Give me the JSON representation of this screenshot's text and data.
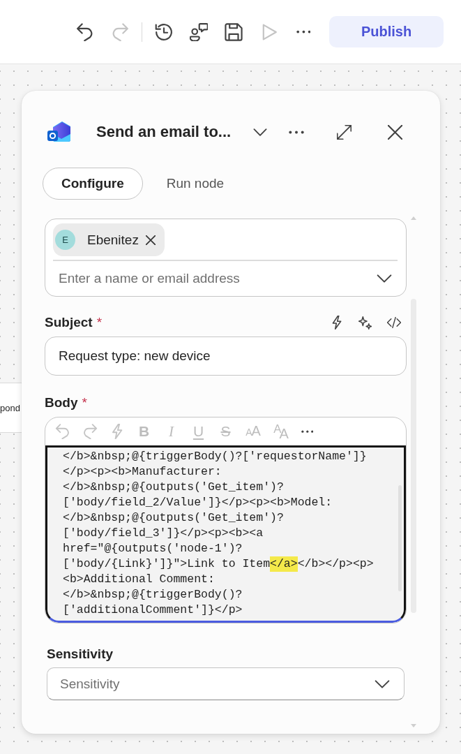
{
  "toolbar": {
    "edit_actions": [
      {
        "kind": "undo",
        "disabled": false
      },
      {
        "kind": "redo",
        "disabled": true
      }
    ],
    "actions": [
      {
        "kind": "history",
        "disabled": false
      },
      {
        "kind": "share",
        "disabled": false
      },
      {
        "kind": "save",
        "disabled": false
      },
      {
        "kind": "run",
        "disabled": true
      },
      {
        "kind": "more",
        "disabled": false
      }
    ],
    "publish_button": "Publish"
  },
  "canvas_node": {
    "label": "pond"
  },
  "panel": {
    "title": "Send an email to...",
    "tabs": [
      {
        "label": "Configure",
        "selected": true
      },
      {
        "label": "Run node",
        "selected": false
      }
    ],
    "to_field": {
      "recipients": [
        {
          "initial": "E",
          "name": "Ebenitez"
        }
      ],
      "placeholder": "Enter a name or email address"
    },
    "subject": {
      "label": "Subject",
      "required_mark": "*",
      "value": "Request type: new device"
    },
    "body": {
      "label": "Body",
      "required_mark": "*",
      "toolbar": [
        {
          "kind": "undo",
          "disabled": true
        },
        {
          "kind": "redo",
          "disabled": true
        },
        {
          "kind": "dynamic",
          "disabled": true
        },
        {
          "kind": "bold",
          "label": "B",
          "disabled": true
        },
        {
          "kind": "italic",
          "label": "I",
          "disabled": true
        },
        {
          "kind": "underline",
          "label": "U",
          "disabled": true
        },
        {
          "kind": "strikethrough",
          "label": "S",
          "disabled": true
        },
        {
          "kind": "font_size",
          "label": "AA",
          "disabled": true
        },
        {
          "kind": "text_style",
          "label": "$^{A}$A",
          "disabled": true
        },
        {
          "kind": "more",
          "disabled": false
        }
      ],
      "code_lines": [
        {
          "text": "</b>&nbsp;@{triggerBody()?['requestorName']}"
        },
        {
          "text": "</p><p><b>Manufacturer:"
        },
        {
          "text": "</b>&nbsp;@{outputs('Get_item')?"
        },
        {
          "text": "['body/field_2/Value']}</p><p><b>Model:"
        },
        {
          "text": "</b>&nbsp;@{outputs('Get_item')?"
        },
        {
          "text": "['body/field_3']}</p><p><b><a"
        },
        {
          "text": "href=\"@{outputs('node-1')?"
        },
        {
          "parts": [
            {
              "text": "['body/{Link}']}\">Link to Item",
              "highlighted": false
            },
            {
              "text": "</a>",
              "highlighted": true
            },
            {
              "text": "</b></p><p>",
              "highlighted": false
            }
          ]
        },
        {
          "text": "<b>Additional Comment:"
        },
        {
          "text": "</b>&nbsp;@{triggerBody()?"
        },
        {
          "text": "['additionalComment']}</p>"
        }
      ]
    },
    "sensitivity": {
      "label": "Sensitivity",
      "placeholder": "Sensitivity"
    }
  }
}
